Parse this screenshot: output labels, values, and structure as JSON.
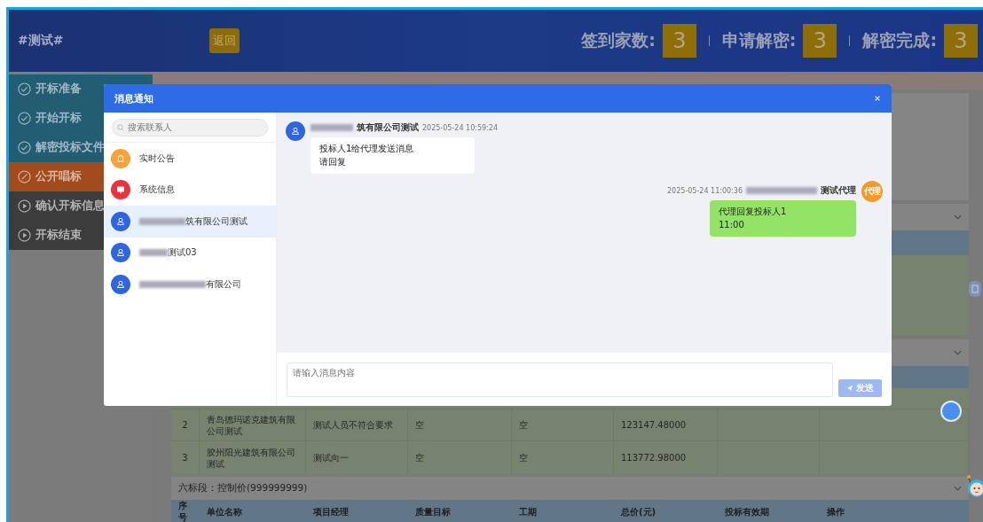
{
  "header": {
    "title": "#测试#",
    "back_button": "返回",
    "stats": [
      {
        "label": "签到家数:",
        "value": "3"
      },
      {
        "label": "申请解密:",
        "value": "3"
      },
      {
        "label": "解密完成:",
        "value": "3"
      }
    ]
  },
  "sidebar": {
    "items": [
      {
        "label": "开标准备",
        "kind": "done"
      },
      {
        "label": "开始开标",
        "kind": "done"
      },
      {
        "label": "解密投标文件",
        "kind": "done"
      },
      {
        "label": "公开唱标",
        "kind": "current"
      },
      {
        "label": "确认开标信息",
        "kind": "pending"
      },
      {
        "label": "开标结束",
        "kind": "pending"
      }
    ]
  },
  "table": {
    "rows": [
      {
        "index": "2",
        "company": "青岛德玛诺克建筑有限公司测试",
        "manager": "测试人员不符合要求",
        "quality": "空",
        "period": "空",
        "total": "123147.48000"
      },
      {
        "index": "3",
        "company": "胶州阳光建筑有限公司测试",
        "manager": "测试向一",
        "quality": "空",
        "period": "空",
        "total": "113772.98000"
      }
    ]
  },
  "next_section": {
    "title": "六标段：控制价(999999999)",
    "columns": [
      "序号",
      "单位名称",
      "项目经理",
      "质量目标",
      "工期",
      "总价(元)",
      "投标有效期",
      "操作"
    ]
  },
  "modal": {
    "title": "消息通知",
    "search_placeholder": "搜索联系人",
    "contacts": [
      {
        "name": "实时公告",
        "kind": "announcement",
        "selected": false,
        "blurred": false
      },
      {
        "name": "系统信息",
        "kind": "system",
        "selected": false,
        "blurred": false
      },
      {
        "name": "筑有限公司测试",
        "kind": "user",
        "selected": true,
        "blurred": true
      },
      {
        "name": "测试03",
        "kind": "user",
        "selected": false,
        "blurred": true
      },
      {
        "name": "有限公司",
        "kind": "user",
        "selected": false,
        "blurred": true
      }
    ],
    "messages": [
      {
        "kind": "in",
        "sender": "筑有限公司测试",
        "time": "2025-05-24 10:59:24",
        "lines": [
          "投标人1给代理发送消息",
          "请回复"
        ]
      },
      {
        "kind": "out",
        "sender": "测试代理",
        "avatar_text": "代理",
        "time": "2025-05-24 11:00:36",
        "lines": [
          "代理回复投标人1",
          "11:00"
        ]
      }
    ],
    "input_placeholder": "请输入消息内容",
    "send_button": "发送"
  }
}
